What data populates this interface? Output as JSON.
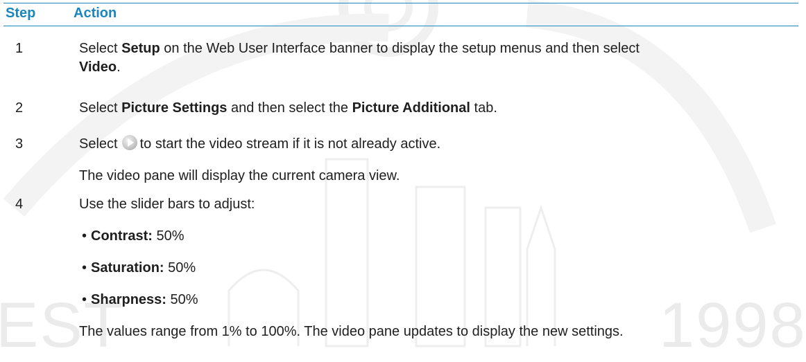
{
  "header": {
    "step": "Step",
    "action": "Action"
  },
  "watermark": {
    "left": "EST",
    "right": "1998"
  },
  "rows": [
    {
      "step": "1",
      "parts": [
        "Select ",
        "Setup",
        " on the Web User Interface banner to display the setup menus and then select",
        "Video",
        "."
      ]
    },
    {
      "step": "2",
      "parts": [
        "Select ",
        "Picture Settings",
        " and then select the ",
        "Picture Additional",
        " tab."
      ]
    },
    {
      "step": "3",
      "select": "Select",
      "icon": "play-icon",
      "after": "to start the video stream if it is not already active.",
      "note": "The video pane will display the current camera view."
    },
    {
      "step": "4",
      "intro": "Use the slider bars to adjust:",
      "bullet": "•",
      "items": [
        {
          "label": "Contrast:",
          "value": " 50%"
        },
        {
          "label": "Saturation:",
          "value": " 50%"
        },
        {
          "label": "Sharpness:",
          "value": " 50%"
        }
      ],
      "footer": "The values range from 1% to 100%. The video pane updates to display the new settings."
    }
  ],
  "colors": {
    "accent": "#1a85bf",
    "rule": "#1a8bc0",
    "text": "#1e1e1e"
  }
}
